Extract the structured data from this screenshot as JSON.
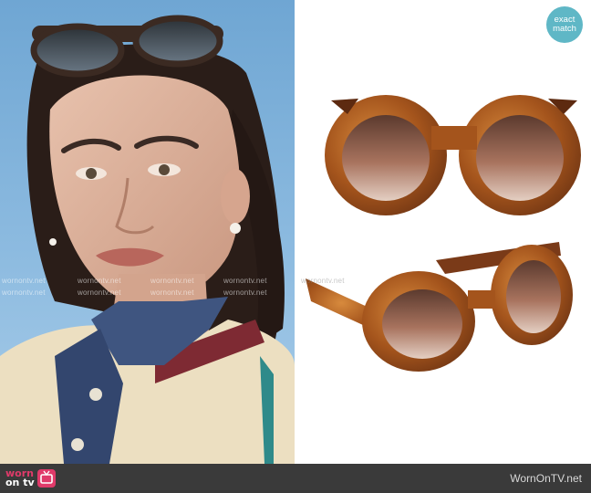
{
  "left_photo": {
    "description_icon": "woman-wearing-sunglasses-photo"
  },
  "right_photo": {
    "description_icon": "tortoiseshell-round-sunglasses-product-photo"
  },
  "badge": {
    "line1": "exact",
    "line2": "match",
    "color": "#5fb7c6"
  },
  "watermark": {
    "text": "wornontv.net"
  },
  "footer": {
    "logo_line1": "worn",
    "logo_line2": "on tv",
    "site": "WornOnTV.net",
    "accent": "#e03a6a"
  }
}
